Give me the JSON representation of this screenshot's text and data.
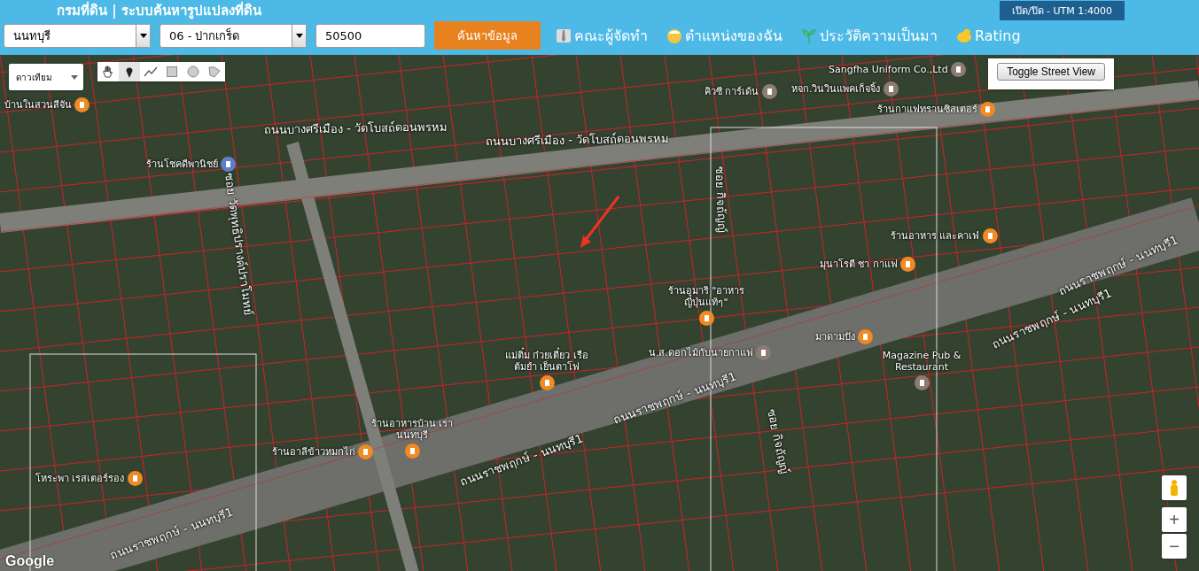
{
  "header": {
    "title": "กรมที่ดิน | ระบบค้นหารูปแปลงที่ดิน",
    "scale_badge": "เปิด/ปิด - UTM 1:4000"
  },
  "search": {
    "province": "นนทบุรี",
    "district": "06 - ปากเกร็ด",
    "parcel_no": "50500",
    "button": "ค้นหาข้อมูล"
  },
  "nav": [
    {
      "kind": "team",
      "label": "คณะผู้จัดทำ"
    },
    {
      "kind": "location",
      "label": "ตำแหน่งของฉัน"
    },
    {
      "kind": "history",
      "label": "ประวัติความเป็นมา"
    },
    {
      "kind": "rating",
      "label": "Rating"
    }
  ],
  "map": {
    "map_type": "ดาวเทียม",
    "street_view_button": "Toggle Street View",
    "tools": [
      {
        "kind": "hand",
        "selected": false
      },
      {
        "kind": "marker",
        "selected": true
      },
      {
        "kind": "line",
        "selected": false
      },
      {
        "kind": "rectangle",
        "selected": false
      },
      {
        "kind": "circle",
        "selected": false
      },
      {
        "kind": "polygon",
        "selected": false
      }
    ],
    "zoom_in": "+",
    "zoom_out": "−",
    "attribution": "Google",
    "labels": [
      {
        "kind": "restaurant",
        "text": "บ้านในสวนสีจัน"
      },
      {
        "kind": "shop",
        "text": "ร้านโชคดีพานิชย์"
      },
      {
        "kind": "road",
        "text": "ถนนบางศรีเมือง - วัดโบสถ์ดอนพรหม"
      },
      {
        "kind": "road",
        "text": "ถนนบางศรีเมือง - วัดโบสถ์ดอนพรหม"
      },
      {
        "kind": "place",
        "text": "Sangfha Uniform Co.,Ltd"
      },
      {
        "kind": "place",
        "text": "คิวซี การ์เด้น"
      },
      {
        "kind": "place",
        "text": "หจก.วินวินแพคเก็จจิ้ง"
      },
      {
        "kind": "restaurant",
        "text": "ร้านกาแฟทรานซิสเตอร์"
      },
      {
        "kind": "restaurant",
        "text": "ร้านอาหาร และคาเฟ่"
      },
      {
        "kind": "restaurant",
        "text": "มุนาโรตี ชา กาแฟ"
      },
      {
        "kind": "restaurant",
        "text": "ร้านอูมาริ \"อาหาร ญี่ปุ่นแท้ๆ\""
      },
      {
        "kind": "cafe",
        "text": "มาดามปัง"
      },
      {
        "kind": "restaurant",
        "text": "แม่ติ๋ม ก๋วยเตี๋ยว เรือ ต้มยำ เย็นตาโฟ"
      },
      {
        "kind": "place",
        "text": "น.ส.ดอกไม้กับนายกาแฟ"
      },
      {
        "kind": "place",
        "text": "Magazine Pub & Restaurant"
      },
      {
        "kind": "restaurant",
        "text": "ร้านอาหารบ้าน เรา นนทบุรี"
      },
      {
        "kind": "restaurant",
        "text": "ร้านอาลีข้าวหมกไก่"
      },
      {
        "kind": "restaurant",
        "text": "โหระพา เรสเตอร์รอง"
      },
      {
        "kind": "road",
        "text": "ถนนราชพฤกษ์ - นนทบุรี1"
      },
      {
        "kind": "road",
        "text": "ถนนราชพฤกษ์ - นนทบุรี1"
      },
      {
        "kind": "road",
        "text": "ถนนราชพฤกษ์ - นนทบุรี1"
      },
      {
        "kind": "road",
        "text": "ถนนราชพฤกษ์ - นนทบุรี1"
      },
      {
        "kind": "road",
        "text": "ถนนราชพฤกษ์ - นนทบุรี1"
      },
      {
        "kind": "road",
        "text": "ซอย วัดพุทธิปรางค์ปราโมทย์"
      },
      {
        "kind": "road",
        "text": "ซอย กิจถัญญ์"
      },
      {
        "kind": "road",
        "text": "ซอย กิจถัญญ์"
      }
    ]
  }
}
